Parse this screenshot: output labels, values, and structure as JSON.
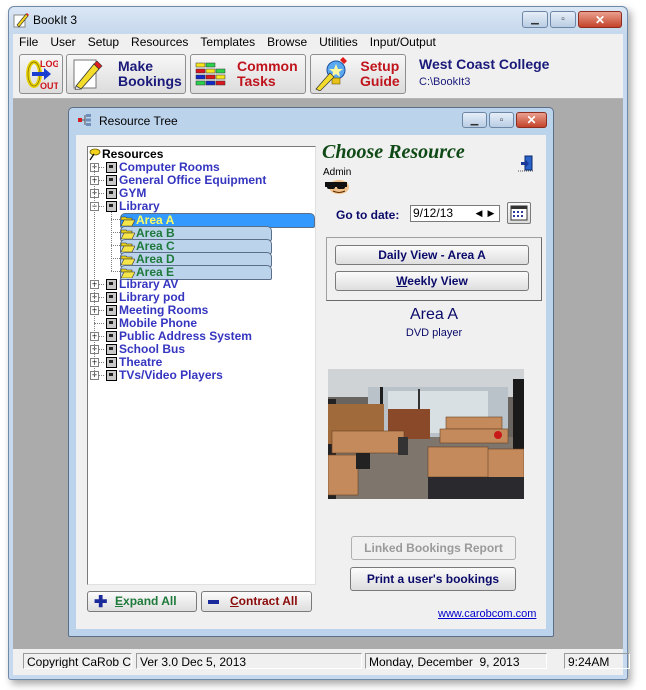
{
  "window": {
    "title": "BookIt 3",
    "controls": {
      "minimize": "minimize",
      "maximize": "maximize",
      "close": "close"
    }
  },
  "menu": [
    "File",
    "User",
    "Setup",
    "Resources",
    "Templates",
    "Browse",
    "Utilities",
    "Input/Output"
  ],
  "toolbar": {
    "logout": {
      "line1": "LOG",
      "line2": "OUT",
      "icon": "logout-icon"
    },
    "make_bookings": {
      "line1": "Make",
      "line2": "Bookings",
      "icon": "pencil-icon",
      "color": "#1a1a7a"
    },
    "common_tasks": {
      "line1": "Common",
      "line2": "Tasks",
      "icon": "grid-icon",
      "color": "#c0141c"
    },
    "setup_guide": {
      "line1": "Setup",
      "line2": "Guide",
      "icon": "lightbulb-icon",
      "color": "#c0141c"
    },
    "org_name": "West Coast College",
    "org_path": "C:\\BookIt3"
  },
  "resource_tree_window": {
    "title": "Resource Tree",
    "tree": {
      "root": "Resources",
      "nodes": [
        {
          "label": "Computer Rooms",
          "expandable": true,
          "expanded": false
        },
        {
          "label": "General Office Equipment",
          "expandable": true,
          "expanded": false
        },
        {
          "label": "GYM",
          "expandable": true,
          "expanded": false
        },
        {
          "label": "Library",
          "expandable": true,
          "expanded": true,
          "children": [
            "Area A",
            "Area B",
            "Area C",
            "Area D",
            "Area E"
          ],
          "selected_child": "Area A"
        },
        {
          "label": "Library AV",
          "expandable": true,
          "expanded": false
        },
        {
          "label": "Library pod",
          "expandable": true,
          "expanded": false
        },
        {
          "label": "Meeting Rooms",
          "expandable": true,
          "expanded": false
        },
        {
          "label": "Mobile Phone",
          "expandable": false,
          "expanded": false
        },
        {
          "label": "Public Address System",
          "expandable": true,
          "expanded": false
        },
        {
          "label": "School Bus",
          "expandable": true,
          "expanded": false
        },
        {
          "label": "Theatre",
          "expandable": true,
          "expanded": false
        },
        {
          "label": "TVs/Video Players",
          "expandable": true,
          "expanded": false
        }
      ]
    },
    "expand_all": {
      "prefix": "",
      "accel": "E",
      "rest": "xpand All"
    },
    "contract_all": {
      "prefix": "",
      "accel": "C",
      "rest": "ontract All"
    },
    "heading": "Choose Resource",
    "user_role": "Admin",
    "goto_label": "Go to date:",
    "goto_value": "9/12/13",
    "daily_view": "Daily View - Area A",
    "weekly_view": {
      "accel": "W",
      "rest": "eekly View"
    },
    "resource_name": "Area A",
    "resource_desc": "DVD player",
    "linked_report": "Linked Bookings Report",
    "print_bookings": "Print a user's bookings",
    "website": "www.carobcom.com"
  },
  "status": {
    "copyright": "Copyright CaRob Co",
    "version": "Ver 3.0 Dec 5, 2013",
    "date": "Monday, December  9, 2013",
    "time": "9:24AM"
  }
}
